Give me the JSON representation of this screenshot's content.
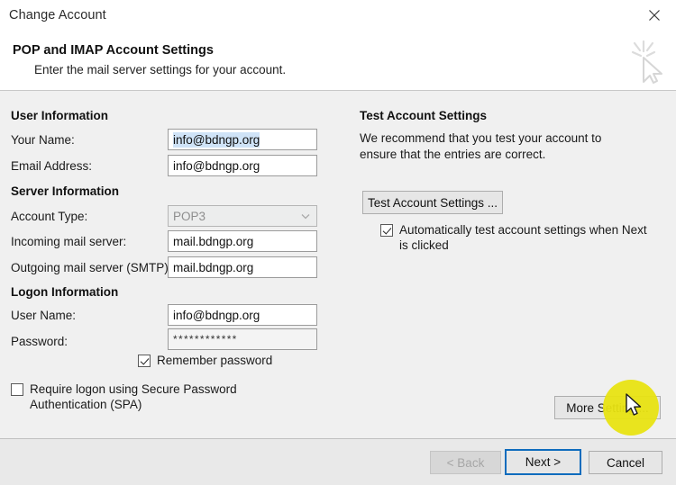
{
  "window": {
    "title": "Change Account",
    "close_icon": "close-icon"
  },
  "header": {
    "title": "POP and IMAP Account Settings",
    "subtitle": "Enter the mail server settings for your account.",
    "decor_icon": "cursor-sparkle-icon"
  },
  "sections": {
    "user_information": "User Information",
    "server_information": "Server Information",
    "logon_information": "Logon Information"
  },
  "fields": {
    "your_name": {
      "label": "Your Name:",
      "value": "info@bdngp.org",
      "selected": true
    },
    "email_address": {
      "label": "Email Address:",
      "value": "info@bdngp.org"
    },
    "account_type": {
      "label": "Account Type:",
      "value": "POP3",
      "disabled": true
    },
    "incoming_server": {
      "label": "Incoming mail server:",
      "value": "mail.bdngp.org"
    },
    "outgoing_server": {
      "label": "Outgoing mail server (SMTP):",
      "value": "mail.bdngp.org"
    },
    "user_name": {
      "label": "User Name:",
      "value": "info@bdngp.org"
    },
    "password": {
      "label": "Password:",
      "value": "************"
    }
  },
  "checkboxes": {
    "remember_password": {
      "label": "Remember password",
      "checked": true
    },
    "require_spa": {
      "label": "Require logon using Secure Password Authentication (SPA)",
      "checked": false
    },
    "auto_test": {
      "label": "Automatically test account settings when Next is clicked",
      "checked": true
    }
  },
  "test_panel": {
    "title": "Test Account Settings",
    "description": "We recommend that you test your account to ensure that the entries are correct.",
    "button": "Test Account Settings ..."
  },
  "buttons": {
    "more_settings": "More Setting ...",
    "back": "< Back",
    "next": "Next >",
    "cancel": "Cancel"
  },
  "colors": {
    "accent": "#0f6cbd",
    "selection": "#cfe3f7",
    "highlight": "#e8e312",
    "body_bg": "#f0f0f0"
  }
}
